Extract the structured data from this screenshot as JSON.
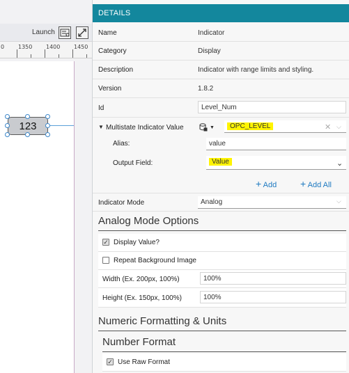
{
  "canvas": {
    "launch_label": "Launch",
    "ruler_labels": [
      "0",
      "1350",
      "1400",
      "1450"
    ],
    "widget_value": "123"
  },
  "details": {
    "header": "DETAILS",
    "name_label": "Name",
    "name_value": "Indicator",
    "category_label": "Category",
    "category_value": "Display",
    "description_label": "Description",
    "description_value": "Indicator with range limits and styling.",
    "version_label": "Version",
    "version_value": "1.8.2",
    "id_label": "Id",
    "id_value": "Level_Num",
    "multistate_label": "Multistate Indicator Value",
    "multistate_value": "OPC_LEVEL",
    "alias_label": "Alias:",
    "alias_value": "value",
    "output_label": "Output Field:",
    "output_value": "Value",
    "add_label": "Add",
    "add_all_label": "Add All",
    "indicator_mode_label": "Indicator Mode",
    "indicator_mode_value": "Analog",
    "analog_title": "Analog Mode Options",
    "display_value_label": "Display Value?",
    "display_value_checked": true,
    "repeat_bg_label": "Repeat Background Image",
    "repeat_bg_checked": false,
    "width_label": "Width (Ex. 200px, 100%)",
    "width_value": "100%",
    "height_label": "Height (Ex. 150px, 100%)",
    "height_value": "100%",
    "numeric_title": "Numeric Formatting & Units",
    "number_format_title": "Number Format",
    "use_raw_label": "Use Raw Format",
    "use_raw_checked": true
  },
  "colors": {
    "header_bg": "#13879d",
    "highlight": "#fff400",
    "link": "#1f7ac1"
  }
}
